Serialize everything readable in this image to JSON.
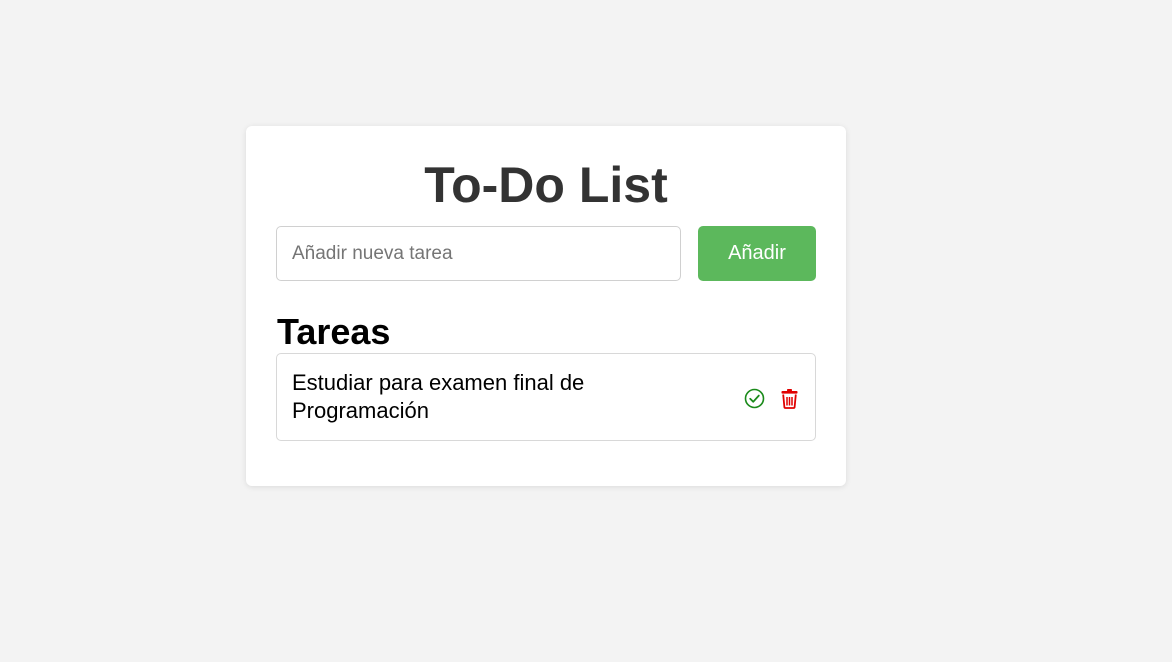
{
  "app": {
    "title": "To-Do List"
  },
  "add_form": {
    "placeholder": "Añadir nueva tarea",
    "value": "",
    "button_label": "Añadir"
  },
  "tasks_section": {
    "title": "Tareas",
    "items": [
      {
        "text": "Estudiar para examen final de Programación",
        "complete_icon": "check-circle-icon",
        "delete_icon": "trash-icon"
      }
    ]
  },
  "colors": {
    "background": "#f3f3f3",
    "card": "#ffffff",
    "accent_green": "#5cb85c",
    "complete_icon": "#1a8a1a",
    "delete_icon": "#e00000"
  }
}
